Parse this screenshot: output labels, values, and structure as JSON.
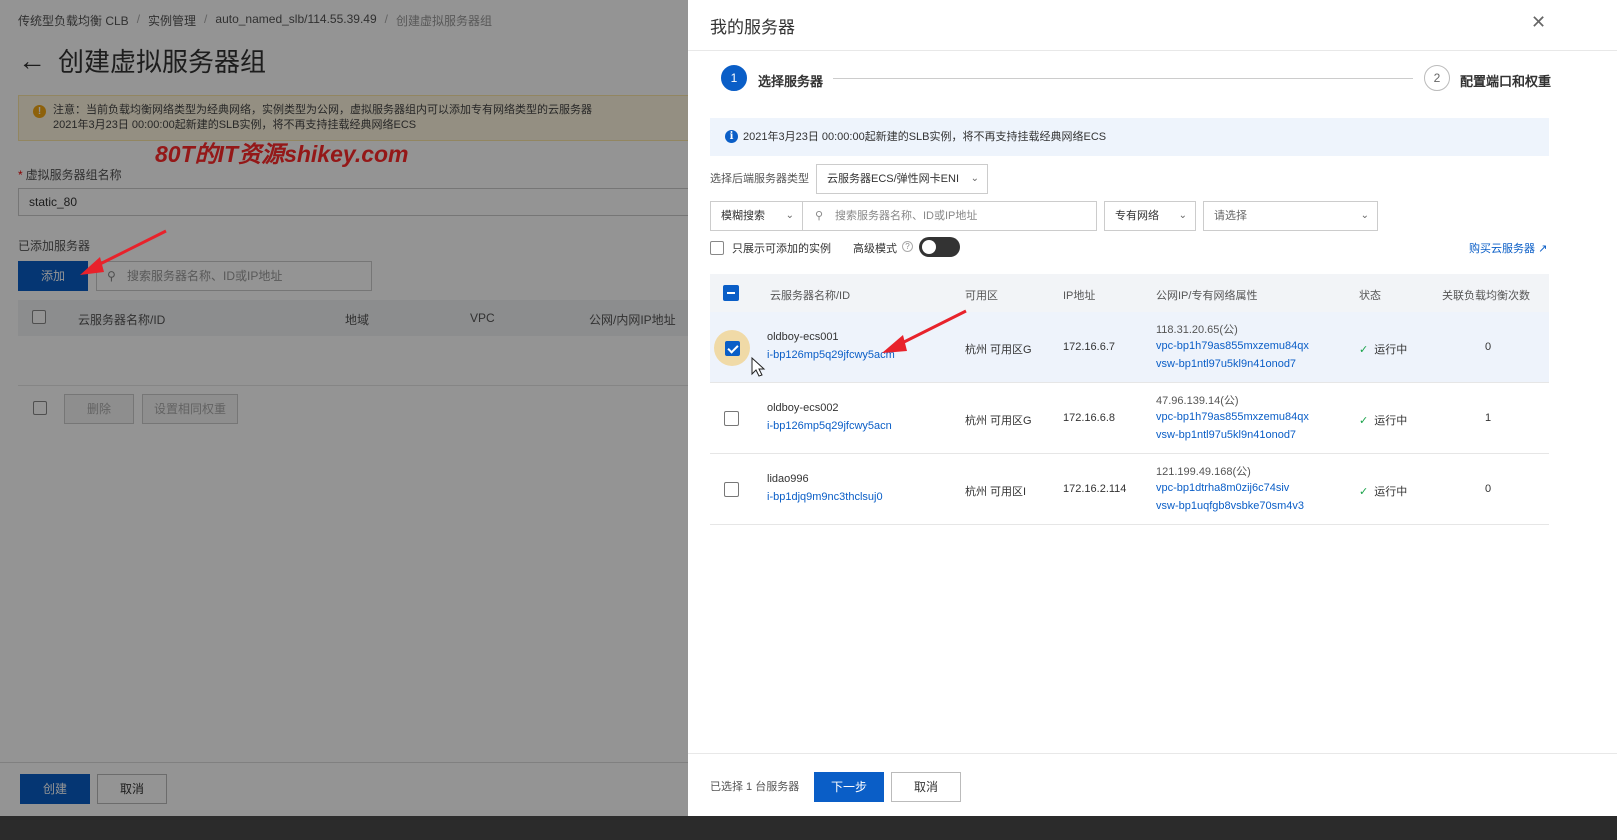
{
  "breadcrumb": [
    "传统型负载均衡 CLB",
    "实例管理",
    "auto_named_slb/114.55.39.49",
    "创建虚拟服务器组"
  ],
  "page": {
    "title": "创建虚拟服务器组",
    "notice_line1": "注意：当前负载均衡网络类型为经典网络，实例类型为公网，虚拟服务器组内可以添加专有网络类型的云服务器",
    "notice_line2": "2021年3月23日 00:00:00起新建的SLB实例，将不再支持挂载经典网络ECS",
    "watermark": "80T的IT资源shikey.com",
    "group_name_label": "虚拟服务器组名称",
    "group_name_value": "static_80",
    "added_servers_label": "已添加服务器",
    "add_button": "添加",
    "search_placeholder": "搜索服务器名称、ID或IP地址",
    "columns": [
      "云服务器名称/ID",
      "地域",
      "VPC",
      "公网/内网IP地址"
    ],
    "delete_button": "删除",
    "set_weight_button": "设置相同权重",
    "create_button": "创建",
    "cancel_button": "取消"
  },
  "drawer": {
    "title": "我的服务器",
    "close_icon": "close-icon",
    "steps": [
      {
        "num": "1",
        "label": "选择服务器"
      },
      {
        "num": "2",
        "label": "配置端口和权重"
      }
    ],
    "info": "2021年3月23日 00:00:00起新建的SLB实例，将不再支持挂载经典网络ECS",
    "backend_type_label": "选择后端服务器类型",
    "backend_type_value": "云服务器ECS/弹性网卡ENI",
    "search_mode": "模糊搜索",
    "search_placeholder": "搜索服务器名称、ID或IP地址",
    "network_type": "专有网络",
    "vpc_select": "请选择",
    "only_addable_label": "只展示可添加的实例",
    "advanced_mode_label": "高级模式",
    "buy_link": "购买云服务器",
    "columns": [
      "云服务器名称/ID",
      "可用区",
      "IP地址",
      "公网IP/专有网络属性",
      "状态",
      "关联负载均衡次数"
    ],
    "rows": [
      {
        "name": "oldboy-ecs001",
        "id": "i-bp126mp5q29jfcwy5acm",
        "zone": "杭州 可用区G",
        "ip": "172.16.6.7",
        "public_ip": "118.31.20.65(公)",
        "vpc": "vpc-bp1h79as855mxzemu84qx",
        "vsw": "vsw-bp1ntl97u5kl9n41onod7",
        "status": "运行中",
        "count": "0",
        "checked": true
      },
      {
        "name": "oldboy-ecs002",
        "id": "i-bp126mp5q29jfcwy5acn",
        "zone": "杭州 可用区G",
        "ip": "172.16.6.8",
        "public_ip": "47.96.139.14(公)",
        "vpc": "vpc-bp1h79as855mxzemu84qx",
        "vsw": "vsw-bp1ntl97u5kl9n41onod7",
        "status": "运行中",
        "count": "1",
        "checked": false
      },
      {
        "name": "lidao996",
        "id": "i-bp1djq9m9nc3thclsuj0",
        "zone": "杭州 可用区I",
        "ip": "172.16.2.114",
        "public_ip": "121.199.49.168(公)",
        "vpc": "vpc-bp1dtrha8m0zij6c74siv",
        "vsw": "vsw-bp1uqfgb8vsbke70sm4v3",
        "status": "运行中",
        "count": "0",
        "checked": false
      }
    ],
    "selected_text": "已选择 1 台服务器",
    "next_button": "下一步",
    "cancel_button": "取消"
  },
  "colors": {
    "primary": "#0a5ec7",
    "annotation_arrow": "#e8222b",
    "success": "#1aa34a"
  }
}
